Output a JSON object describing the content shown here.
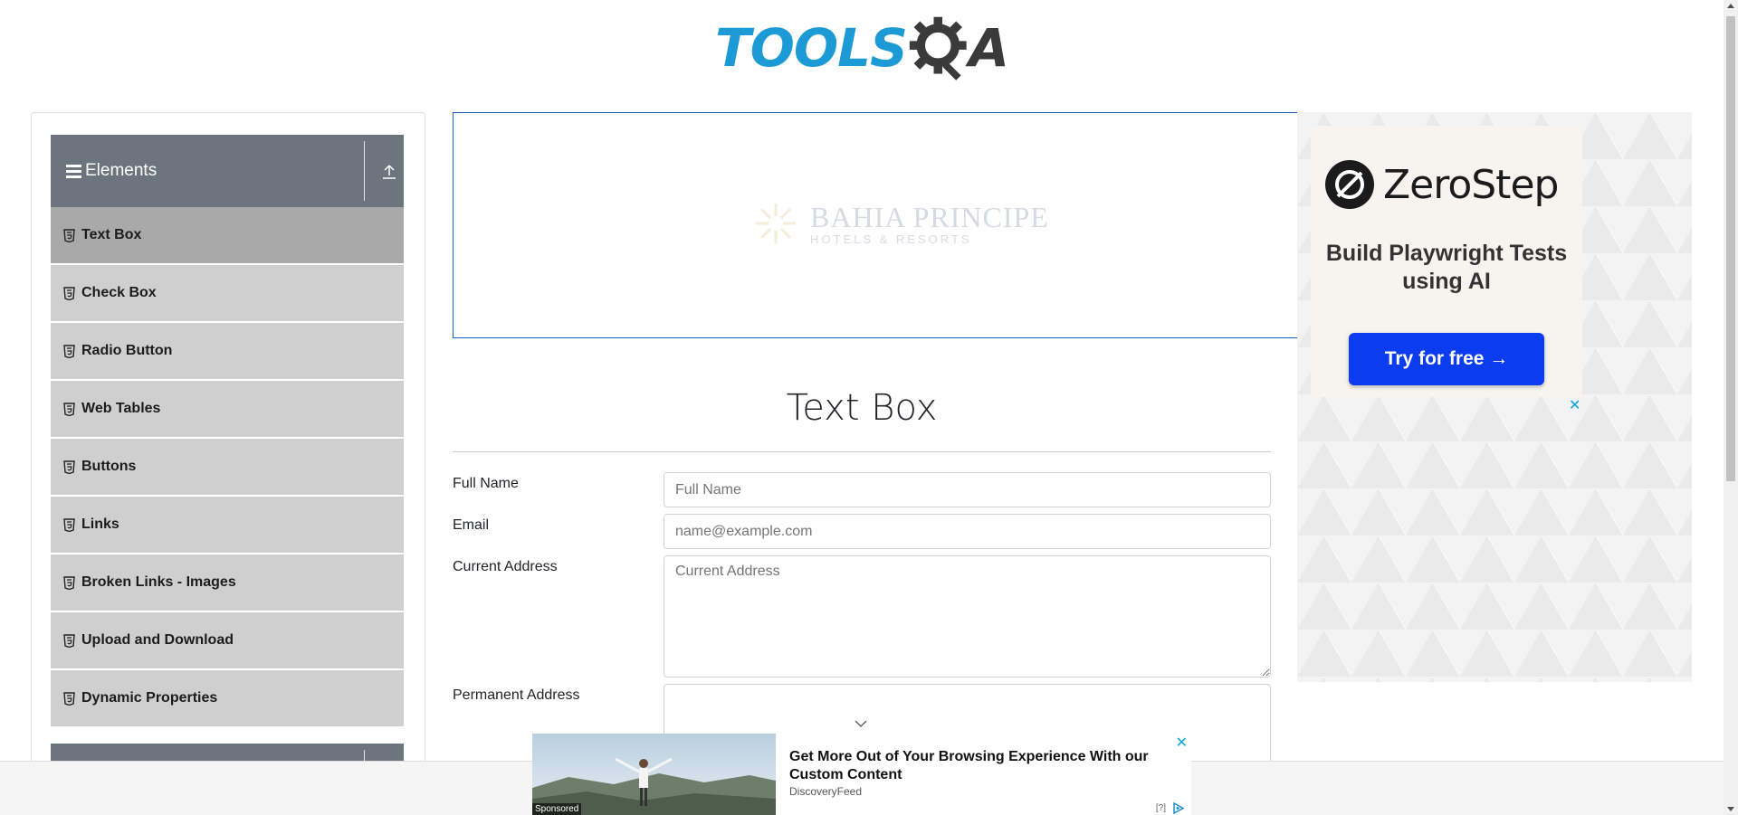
{
  "logo": {
    "part1": "TOOLS",
    "part2": "A",
    "alt": "TOOLSQA"
  },
  "sidebar": {
    "group_title": "Elements",
    "items": [
      {
        "label": "Text Box",
        "active": true
      },
      {
        "label": "Check Box"
      },
      {
        "label": "Radio Button"
      },
      {
        "label": "Web Tables"
      },
      {
        "label": "Buttons"
      },
      {
        "label": "Links"
      },
      {
        "label": "Broken Links - Images"
      },
      {
        "label": "Upload and Download"
      },
      {
        "label": "Dynamic Properties"
      }
    ]
  },
  "banner_ad": {
    "line1": "BAHIA PRINCIPE",
    "line2": "HOTELS & RESORTS"
  },
  "main": {
    "title": "Text Box",
    "full_name": {
      "label": "Full Name",
      "placeholder": "Full Name"
    },
    "email": {
      "label": "Email",
      "placeholder": "name@example.com"
    },
    "current_address": {
      "label": "Current Address",
      "placeholder": "Current Address"
    },
    "permanent_address": {
      "label": "Permanent Address"
    }
  },
  "right_ad": {
    "brand": "ZeroStep",
    "headline": "Build Playwright Tests using AI",
    "cta": "Try for free →",
    "close": "✕"
  },
  "bottom_ad": {
    "headline": "Get More Out of Your Browsing Experience With our Custom Content",
    "source": "DiscoveryFeed",
    "sponsored": "Sponsored",
    "help": "[?]",
    "close": "✕"
  },
  "colors": {
    "brand_blue": "#1c9ad6",
    "sidebar_header": "#6c757d",
    "menu_item": "#cfcfcf",
    "menu_active": "#a9a9a9",
    "cta_blue": "#0b3cf0"
  }
}
